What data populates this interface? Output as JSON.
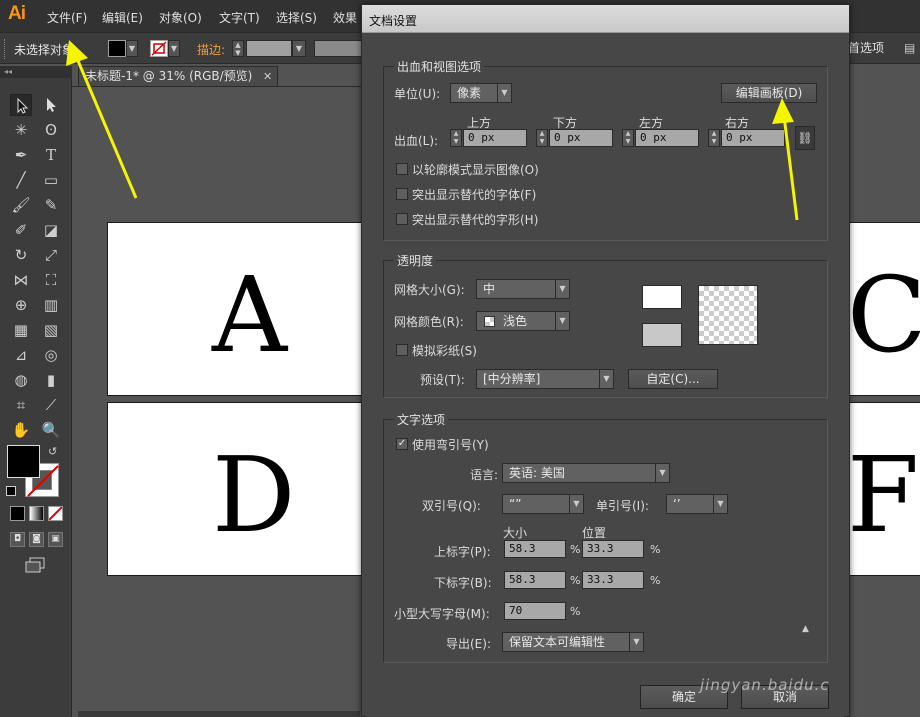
{
  "app": {
    "logo": "Ai"
  },
  "menubar": {
    "items": [
      "文件(F)",
      "编辑(E)",
      "对象(O)",
      "文字(T)",
      "选择(S)",
      "效果"
    ]
  },
  "controlbar": {
    "selection_status": "未选择对象",
    "stroke_label": "描边:",
    "preferences_label": "首选项"
  },
  "document_tab": {
    "title": "未标题-1* @ 31% (RGB/预览)",
    "close": "✕"
  },
  "artboards": {
    "letters": [
      "A",
      "C",
      "D",
      "F"
    ]
  },
  "dialog": {
    "title": "文档设置",
    "bleed_group": {
      "title": "出血和视图选项",
      "unit_label": "单位(U):",
      "unit_value": "像素",
      "edit_artboards_button": "编辑画板(D)",
      "bleed_label": "出血(L):",
      "top_label": "上方",
      "bottom_label": "下方",
      "left_label": "左方",
      "right_label": "右方",
      "top_value": "0 px",
      "bottom_value": "0 px",
      "left_value": "0 px",
      "right_value": "0 px",
      "show_outline_label": "以轮廓模式显示图像(O)",
      "highlight_fonts_label": "突出显示替代的字体(F)",
      "highlight_glyphs_label": "突出显示替代的字形(H)"
    },
    "transparency_group": {
      "title": "透明度",
      "grid_size_label": "网格大小(G):",
      "grid_size_value": "中",
      "grid_color_label": "网格颜色(R):",
      "grid_color_value": "浅色",
      "simulate_paper_label": "模拟彩纸(S)",
      "preset_label": "预设(T):",
      "preset_value": "[中分辨率]",
      "custom_button": "自定(C)..."
    },
    "type_group": {
      "title": "文字选项",
      "use_quotes_label": "使用弯引号(Y)",
      "use_quotes_checked": true,
      "language_label": "语言:",
      "language_value": "英语: 美国",
      "double_quotes_label": "双引号(Q):",
      "double_quotes_value": "“”",
      "single_quotes_label": "单引号(I):",
      "single_quotes_value": "‘’",
      "size_header": "大小",
      "position_header": "位置",
      "superscript_label": "上标字(P):",
      "superscript_size": "58.3",
      "superscript_position": "33.3",
      "subscript_label": "下标字(B):",
      "subscript_size": "58.3",
      "subscript_position": "33.3",
      "smallcaps_label": "小型大写字母(M):",
      "smallcaps_value": "70",
      "percent": "%",
      "export_label": "导出(E):",
      "export_value": "保留文本可编辑性"
    },
    "ok_button": "确定",
    "cancel_button": "取消"
  },
  "watermark": "jingyan.baidu.c",
  "colors": {
    "accent_arrow": "#f5f500",
    "stroke_label": "#f09c3c",
    "logo": "#f7941d"
  }
}
